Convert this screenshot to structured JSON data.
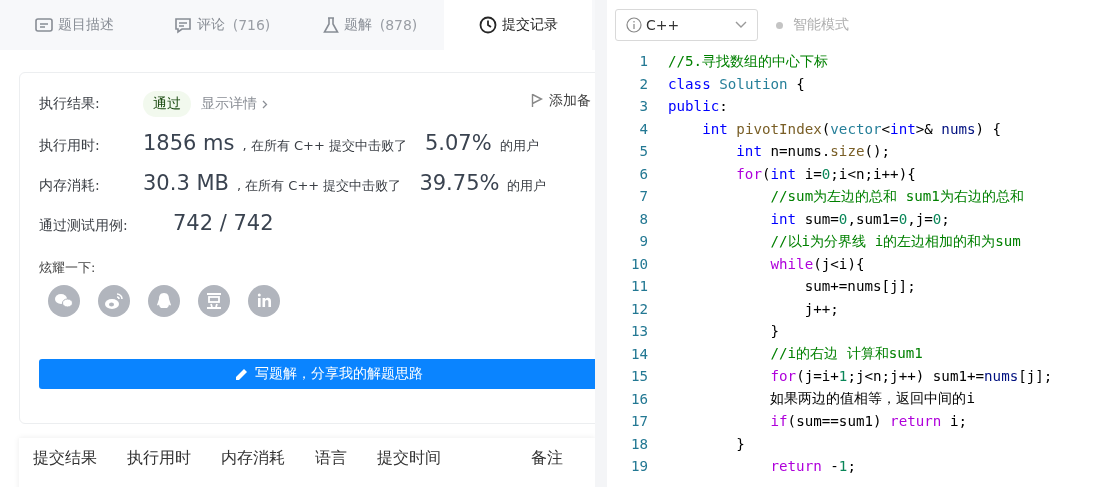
{
  "tabs": [
    {
      "kind": "description",
      "label": "题目描述",
      "selected": false
    },
    {
      "kind": "comments",
      "label": "评论",
      "count": "(716)",
      "selected": false
    },
    {
      "kind": "solutions",
      "label": "题解",
      "count": "(878)",
      "selected": false
    },
    {
      "kind": "submissions",
      "label": "提交记录",
      "selected": true
    }
  ],
  "result": {
    "label": "执行结果:",
    "status": "通过",
    "details_link": "显示详情",
    "add_note": "添加备"
  },
  "stats": [
    {
      "label": "执行用时:",
      "value": "1856 ms",
      "text": ", 在所有 C++ 提交中击败了",
      "percent": "5.07%",
      "suffix": "的用户"
    },
    {
      "label": "内存消耗:",
      "value": "30.3 MB",
      "text": ", 在所有 C++ 提交中击败了",
      "percent": "39.75%",
      "suffix": "的用户"
    }
  ],
  "tests": {
    "label": "通过测试用例:",
    "value": "742 / 742"
  },
  "share": {
    "label": "炫耀一下:",
    "icons": [
      {
        "kind": "wechat"
      },
      {
        "kind": "weibo"
      },
      {
        "kind": "qq"
      },
      {
        "kind": "douban"
      },
      {
        "kind": "linkedin"
      }
    ]
  },
  "write_button": "写题解，分享我的解题思路",
  "table": {
    "columns": [
      "提交结果",
      "执行用时",
      "内存消耗",
      "语言",
      "提交时间",
      "备注"
    ]
  },
  "editor": {
    "language": "C++",
    "mode": "智能模式",
    "lines": [
      {
        "number": "1",
        "tokens": [
          {
            "kind": "cmt",
            "text": "//5.寻找数组的中心下标"
          }
        ]
      },
      {
        "number": "2",
        "tokens": [
          {
            "kind": "kw",
            "text": "class"
          },
          {
            "kind": "type",
            "text": " Solution"
          },
          {
            "kind": "plain",
            "text": " {"
          }
        ]
      },
      {
        "number": "3",
        "tokens": [
          {
            "kind": "kw",
            "text": "public"
          },
          {
            "kind": "plain",
            "text": ":"
          }
        ]
      },
      {
        "number": "4",
        "tokens": [
          {
            "kind": "kw",
            "text": "    int"
          },
          {
            "kind": "fn",
            "text": " pivotIndex"
          },
          {
            "kind": "plain",
            "text": "("
          },
          {
            "kind": "type",
            "text": "vector"
          },
          {
            "kind": "plain",
            "text": "<"
          },
          {
            "kind": "kw",
            "text": "int"
          },
          {
            "kind": "plain",
            "text": ">& "
          },
          {
            "kind": "var",
            "text": "nums"
          },
          {
            "kind": "plain",
            "text": ") {"
          }
        ]
      },
      {
        "number": "5",
        "tokens": [
          {
            "kind": "kw",
            "text": "        int"
          },
          {
            "kind": "plain",
            "text": " n=nums."
          },
          {
            "kind": "fn",
            "text": "size"
          },
          {
            "kind": "plain",
            "text": "();"
          }
        ]
      },
      {
        "number": "6",
        "tokens": [
          {
            "kind": "ctl",
            "text": "        for"
          },
          {
            "kind": "plain",
            "text": "("
          },
          {
            "kind": "kw",
            "text": "int"
          },
          {
            "kind": "plain",
            "text": " i="
          },
          {
            "kind": "num",
            "text": "0"
          },
          {
            "kind": "plain",
            "text": ";i<n;i++){"
          }
        ]
      },
      {
        "number": "7",
        "tokens": [
          {
            "kind": "cmt",
            "text": "            //sum为左边的总和 sum1为右边的总和"
          }
        ]
      },
      {
        "number": "8",
        "tokens": [
          {
            "kind": "kw",
            "text": "            int"
          },
          {
            "kind": "plain",
            "text": " sum="
          },
          {
            "kind": "num",
            "text": "0"
          },
          {
            "kind": "plain",
            "text": ",sum1="
          },
          {
            "kind": "num",
            "text": "0"
          },
          {
            "kind": "plain",
            "text": ",j="
          },
          {
            "kind": "num",
            "text": "0"
          },
          {
            "kind": "plain",
            "text": ";"
          }
        ]
      },
      {
        "number": "9",
        "tokens": [
          {
            "kind": "cmt",
            "text": "            //以i为分界线 i的左边相加的和为sum"
          }
        ]
      },
      {
        "number": "10",
        "tokens": [
          {
            "kind": "ctl",
            "text": "            while"
          },
          {
            "kind": "plain",
            "text": "(j<i){"
          }
        ]
      },
      {
        "number": "11",
        "tokens": [
          {
            "kind": "plain",
            "text": "                sum+=nums[j];"
          }
        ]
      },
      {
        "number": "12",
        "tokens": [
          {
            "kind": "plain",
            "text": "                j++;"
          }
        ]
      },
      {
        "number": "13",
        "tokens": [
          {
            "kind": "plain",
            "text": "            }"
          }
        ]
      },
      {
        "number": "14",
        "tokens": [
          {
            "kind": "cmt",
            "text": "            //i的右边 计算和sum1"
          }
        ]
      },
      {
        "number": "15",
        "tokens": [
          {
            "kind": "ctl",
            "text": "            for"
          },
          {
            "kind": "plain",
            "text": "(j=i+"
          },
          {
            "kind": "num",
            "text": "1"
          },
          {
            "kind": "plain",
            "text": ";j<n;j++) sum1+="
          },
          {
            "kind": "var",
            "text": "nums"
          },
          {
            "kind": "plain",
            "text": "[j];"
          }
        ]
      },
      {
        "number": "16",
        "tokens": [
          {
            "kind": "plain",
            "text": "            如果两边的值相等，返回中间的i"
          }
        ]
      },
      {
        "number": "17",
        "tokens": [
          {
            "kind": "ctl",
            "text": "            if"
          },
          {
            "kind": "plain",
            "text": "(sum==sum1) "
          },
          {
            "kind": "ctl",
            "text": "return"
          },
          {
            "kind": "plain",
            "text": " i;"
          }
        ]
      },
      {
        "number": "18",
        "tokens": [
          {
            "kind": "plain",
            "text": "        }"
          }
        ]
      },
      {
        "number": "19",
        "tokens": [
          {
            "kind": "ctl",
            "text": "            return"
          },
          {
            "kind": "plain",
            "text": " -"
          },
          {
            "kind": "num",
            "text": "1"
          },
          {
            "kind": "plain",
            "text": ";"
          }
        ]
      }
    ]
  }
}
